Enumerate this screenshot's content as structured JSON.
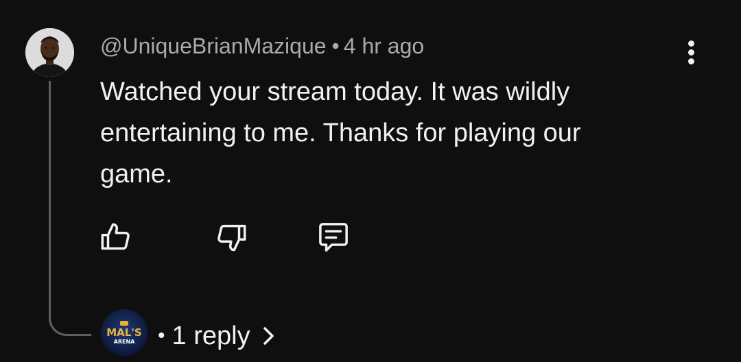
{
  "comment": {
    "author": "@UniqueBrianMazique",
    "separator": "•",
    "time": "4 hr ago",
    "text": "Watched your stream today. It was wildly entertaining to me. Thanks for playing our game."
  },
  "actions": {
    "like_icon": "thumbs-up-icon",
    "dislike_icon": "thumbs-down-icon",
    "reply_icon": "comment-reply-icon",
    "menu_icon": "more-vertical-icon"
  },
  "replies": {
    "avatar_line1": "MAL'S",
    "avatar_line2": "ARENA",
    "bullet": "•",
    "count_label": "1 reply",
    "chevron_icon": "chevron-right-icon"
  },
  "colors": {
    "background": "#0f0f0f",
    "primary_text": "#f1f1f1",
    "secondary_text": "#aaaaaa",
    "thread_line": "#606060"
  }
}
